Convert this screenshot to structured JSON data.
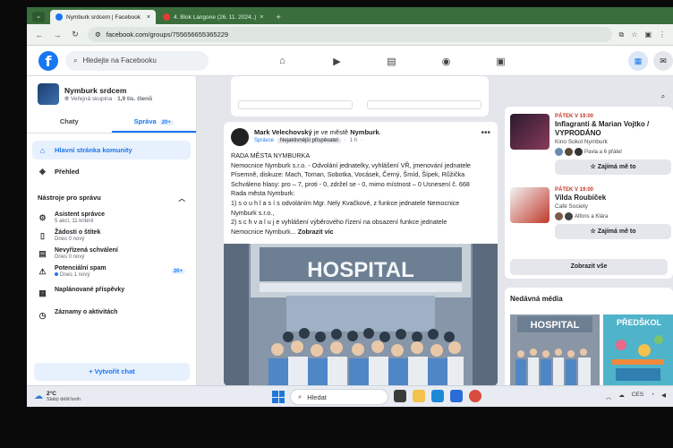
{
  "browser": {
    "tabs": [
      {
        "title": "Nymburk srdcem | Facebook",
        "active": true
      },
      {
        "title": "4. Blok Langone (26. 11. 2024..)",
        "active": false
      }
    ],
    "tab_close": "×",
    "new_tab": "+",
    "tab_menu": "⌄",
    "url": "facebook.com/groups/755656655365229"
  },
  "fb": {
    "logo": "f",
    "search_placeholder": "Hledejte na Facebooku"
  },
  "group": {
    "name": "Nymburk srdcem",
    "privacy": "Veřejná skupina",
    "members": "1,9 tis. členů",
    "tabs": [
      {
        "label": "Chaty"
      },
      {
        "label": "Správa",
        "badge": "20+"
      }
    ]
  },
  "sidebar": {
    "nav": [
      {
        "label": "Hlavní stránka komunity"
      },
      {
        "label": "Přehled"
      }
    ],
    "tools_heading": "Nástroje pro správu",
    "tools": [
      {
        "label": "Asistent správce",
        "sub": "5 akcí, 11 kritérií"
      },
      {
        "label": "Žádosti o štítek",
        "sub": "Dnes 0 nový"
      },
      {
        "label": "Nevyřízená schválení",
        "sub": "Dnes 0 nový"
      },
      {
        "label": "Potenciální spam",
        "sub": "Dnes 1 nový",
        "count": "20+"
      },
      {
        "label": "Naplánované příspěvky",
        "sub": ""
      },
      {
        "label": "Záznamy o aktivitách",
        "sub": ""
      }
    ],
    "create_chat": "+ Vytvořit chat"
  },
  "post": {
    "author": "Mark Velechovský",
    "connector": "je ve městě",
    "location": "Nymburk",
    "badge_role": "Správce",
    "badge_contributor": "Nejaktivnější přispěvatel",
    "time": "1 h",
    "text_lines": [
      "RADA MĚSTA NYMBURKA",
      "Nemocnice Nymburk s.r.o. - Odvolání jednatelky, vyhlášení VŘ, jmenování jednatele",
      "Písemně, diskuze: Mach, Toman, Sobotka, Vocásek, Černý, Šmíd, Šípek, Růžička",
      "Schváleno hlasy: pro – 7, proti - 0, zdržel se - 0, mimo místnost – 0 Usnesení č. 668",
      "Rada města Nymburk:",
      "1) s o u h l a s í s odvoláním Mgr. Nely Kvačkové, z funkce jednatele Nemocnice",
      "Nymburk s.r.o.,",
      "2) s c h v a l u j e vyhlášení výběrového řízení na obsazení funkce jednatele"
    ],
    "last_line": "Nemocnice Nymburk...",
    "see_more": "Zobrazit víc",
    "image_sign": "HOSPITAL"
  },
  "events": [
    {
      "date": "PÁTEK V 19:00",
      "title": "Inflagranti & Marian Vojtko / VYPRODÁNO",
      "place": "Kino Sokol Nymburk",
      "friends": "Pavla a 6 přátel",
      "button": "Zajímá mě to"
    },
    {
      "date": "PÁTEK V 19:00",
      "title": "Vilda Roubíček",
      "place": "Café Society",
      "friends": "Alfons a Klára",
      "button": "Zajímá mě to"
    }
  ],
  "show_all": "Zobrazit vše",
  "media": {
    "heading": "Nedávná média",
    "thumb1_sign": "HOSPITAL",
    "thumb2_sign": "PŘEDŠKOL"
  },
  "taskbar": {
    "temp": "2°C",
    "weather": "Slabý déšť/sníh",
    "search": "Hledat",
    "lang": "CES"
  },
  "colors": {
    "accent": "#1877f2",
    "event_date": "#c0392b"
  }
}
